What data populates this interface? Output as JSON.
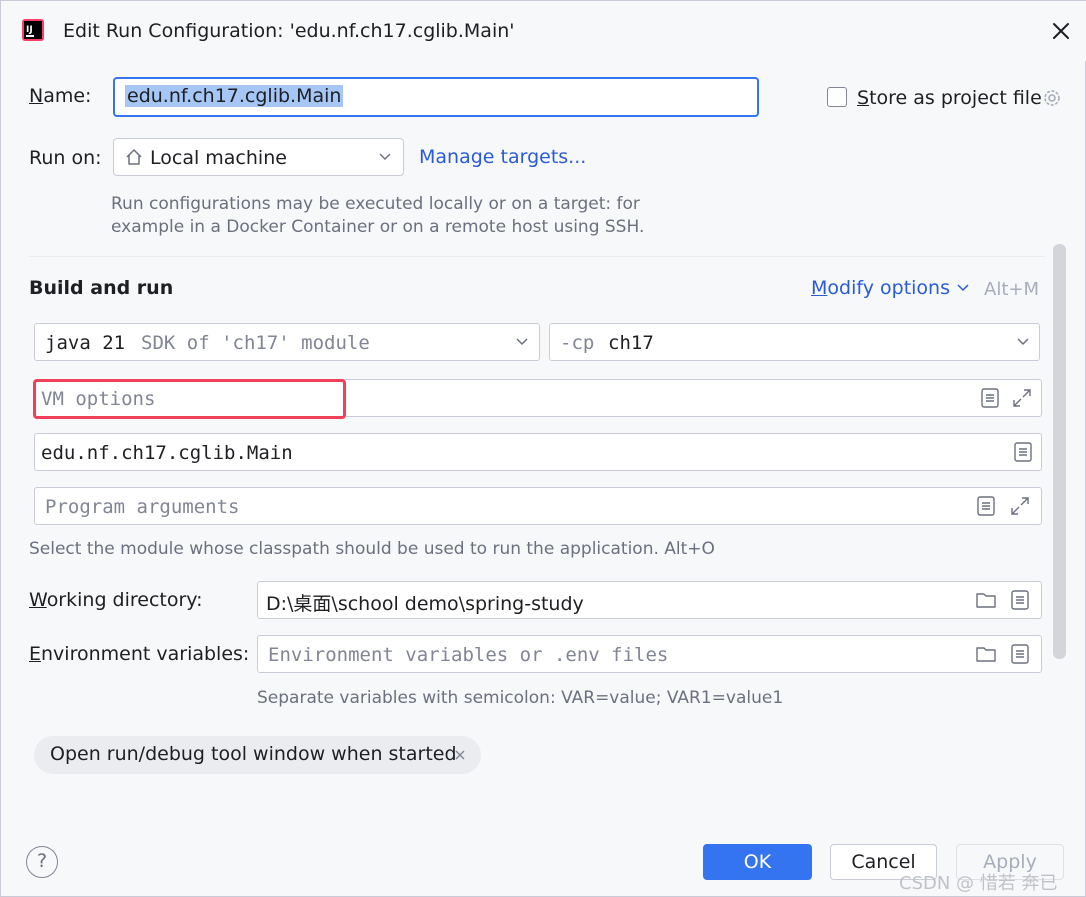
{
  "dialog": {
    "title": "Edit Run Configuration: 'edu.nf.ch17.cglib.Main'"
  },
  "name_row": {
    "label_u": "N",
    "label_rest": "ame:",
    "value": "edu.nf.ch17.cglib.Main"
  },
  "store": {
    "label_u": "S",
    "label_rest": "tore as project file",
    "checked": false
  },
  "run_on": {
    "label": "Run on:",
    "selected": "Local machine",
    "manage_link": "Manage targets...",
    "hint_line1": "Run configurations may be executed locally or on a target: for",
    "hint_line2": "example in a Docker Container or on a remote host using SSH."
  },
  "build": {
    "section_title": "Build and run",
    "modify_u": "M",
    "modify_rest": "odify options",
    "modify_shortcut": "Alt+M",
    "sdk_main": "java 21",
    "sdk_hint": "SDK of 'ch17' module",
    "cp_prefix": "-cp",
    "cp_value": "ch17",
    "vm_placeholder": "VM options",
    "main_class": "edu.nf.ch17.cglib.Main",
    "program_placeholder": "Program arguments",
    "classpath_hint": "Select the module whose classpath should be used to run the application. Alt+O"
  },
  "workdir": {
    "label_u": "W",
    "label_rest": "orking directory:",
    "value": "D:\\桌面\\school demo\\spring-study"
  },
  "env": {
    "label_u": "E",
    "label_rest": "nvironment variables:",
    "placeholder": "Environment variables or .env files",
    "hint": "Separate variables with semicolon: VAR=value; VAR1=value1"
  },
  "chip": {
    "label": "Open run/debug tool window when started"
  },
  "buttons": {
    "help": "?",
    "ok": "OK",
    "cancel": "Cancel",
    "apply": "Apply"
  },
  "watermark": "CSDN @ 惜若 奔已",
  "colors": {
    "accent": "#3574f0",
    "link": "#2a5bd7",
    "highlight": "#f0405a"
  }
}
